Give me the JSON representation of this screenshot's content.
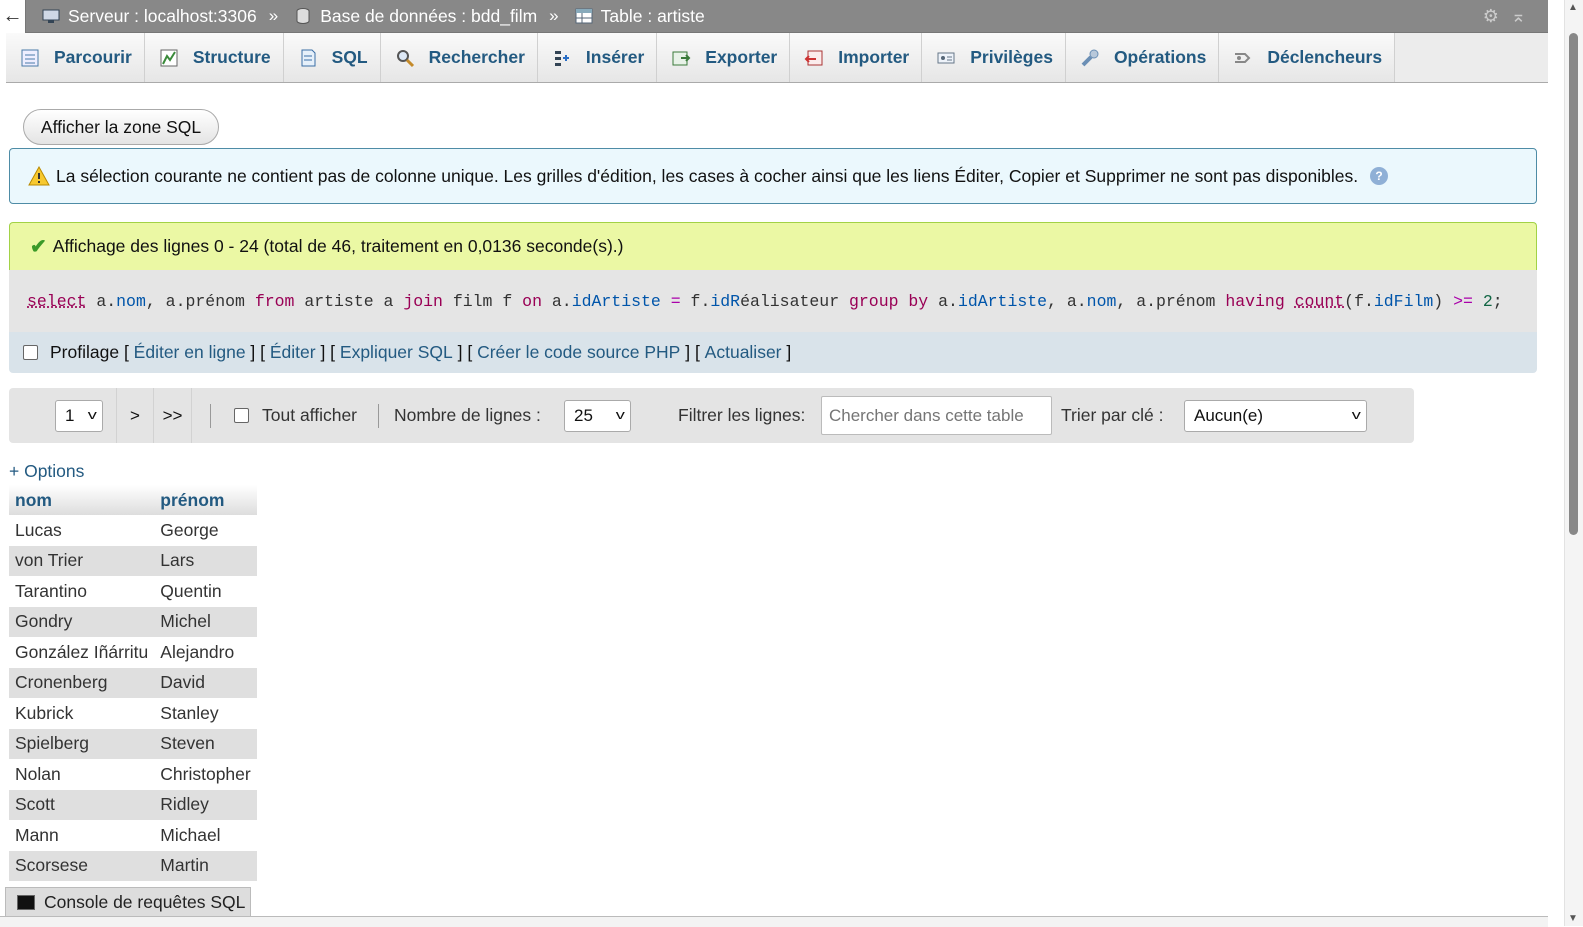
{
  "breadcrumb": {
    "back": "←",
    "server": "Serveur : localhost:3306",
    "database": "Base de données : bdd_film",
    "table": "Table : artiste",
    "separator": "»"
  },
  "tabs": [
    {
      "label": "Parcourir",
      "icon": "browse-icon"
    },
    {
      "label": "Structure",
      "icon": "structure-icon"
    },
    {
      "label": "SQL",
      "icon": "sql-icon"
    },
    {
      "label": "Rechercher",
      "icon": "search-icon"
    },
    {
      "label": "Insérer",
      "icon": "insert-icon"
    },
    {
      "label": "Exporter",
      "icon": "export-icon"
    },
    {
      "label": "Importer",
      "icon": "import-icon"
    },
    {
      "label": "Privilèges",
      "icon": "privileges-icon"
    },
    {
      "label": "Opérations",
      "icon": "operations-icon"
    },
    {
      "label": "Déclencheurs",
      "icon": "triggers-icon"
    }
  ],
  "sql_zone_button": "Afficher la zone SQL",
  "notice": {
    "text": "La sélection courante ne contient pas de colonne unique. Les grilles d'édition, les cases à cocher ainsi que les liens Éditer, Copier et Supprimer ne sont pas disponibles."
  },
  "success": {
    "text": "Affichage des lignes 0 - 24 (total de 46, traitement en 0,0136 seconde(s).)"
  },
  "query_tokens": [
    {
      "t": "select",
      "c": "kwu"
    },
    {
      "t": " ",
      "c": ""
    },
    {
      "t": "a",
      "c": ""
    },
    {
      "t": ".",
      "c": ""
    },
    {
      "t": "nom",
      "c": "col"
    },
    {
      "t": ", ",
      "c": ""
    },
    {
      "t": "a",
      "c": ""
    },
    {
      "t": ".",
      "c": ""
    },
    {
      "t": "prénom",
      "c": ""
    },
    {
      "t": " ",
      "c": ""
    },
    {
      "t": "from",
      "c": "kw"
    },
    {
      "t": " artiste a ",
      "c": ""
    },
    {
      "t": "join",
      "c": "kw"
    },
    {
      "t": " film f ",
      "c": ""
    },
    {
      "t": "on",
      "c": "kw"
    },
    {
      "t": " a.",
      "c": ""
    },
    {
      "t": "idArtiste",
      "c": "col"
    },
    {
      "t": " ",
      "c": ""
    },
    {
      "t": "=",
      "c": "op"
    },
    {
      "t": " f.",
      "c": ""
    },
    {
      "t": "idR",
      "c": "col"
    },
    {
      "t": "éalisateur ",
      "c": ""
    },
    {
      "t": "group by",
      "c": "kw"
    },
    {
      "t": " a.",
      "c": ""
    },
    {
      "t": "idArtiste",
      "c": "col"
    },
    {
      "t": ", a.",
      "c": ""
    },
    {
      "t": "nom",
      "c": "col"
    },
    {
      "t": ", a.prénom ",
      "c": ""
    },
    {
      "t": "having",
      "c": "kw"
    },
    {
      "t": " ",
      "c": ""
    },
    {
      "t": "count",
      "c": "fn"
    },
    {
      "t": "(",
      "c": ""
    },
    {
      "t": "f.",
      "c": ""
    },
    {
      "t": "idFilm",
      "c": "col"
    },
    {
      "t": ") ",
      "c": ""
    },
    {
      "t": ">=",
      "c": "op"
    },
    {
      "t": " ",
      "c": ""
    },
    {
      "t": "2",
      "c": "num"
    },
    {
      "t": ";",
      "c": ""
    }
  ],
  "sql_tools": {
    "profiling_label": "Profilage",
    "links": [
      "Éditer en ligne",
      "Éditer",
      "Expliquer SQL",
      "Créer le code source PHP",
      "Actualiser"
    ]
  },
  "navigation": {
    "page_value": "1",
    "next": ">",
    "last": ">>",
    "show_all_label": "Tout afficher",
    "rows_label": "Nombre de lignes :",
    "rows_value": "25",
    "filter_label": "Filtrer les lignes:",
    "filter_placeholder": "Chercher dans cette table",
    "sort_label": "Trier par clé :",
    "sort_value": "Aucun(e)"
  },
  "options_link": "+ Options",
  "table": {
    "headers": [
      "nom",
      "prénom"
    ],
    "rows": [
      [
        "Lucas",
        "George"
      ],
      [
        "von Trier",
        "Lars"
      ],
      [
        "Tarantino",
        "Quentin"
      ],
      [
        "Gondry",
        "Michel"
      ],
      [
        "González Iñárritu",
        "Alejandro"
      ],
      [
        "Cronenberg",
        "David"
      ],
      [
        "Kubrick",
        "Stanley"
      ],
      [
        "Spielberg",
        "Steven"
      ],
      [
        "Nolan",
        "Christopher"
      ],
      [
        "Scott",
        "Ridley"
      ],
      [
        "Mann",
        "Michael"
      ],
      [
        "Scorsese",
        "Martin"
      ]
    ]
  },
  "console": {
    "label": "Console de requêtes SQL"
  },
  "colors": {
    "link": "#235a81",
    "success_bg": "#ebf8a4",
    "notice_bg": "#ebf8fd",
    "topbar_bg": "#888888"
  }
}
